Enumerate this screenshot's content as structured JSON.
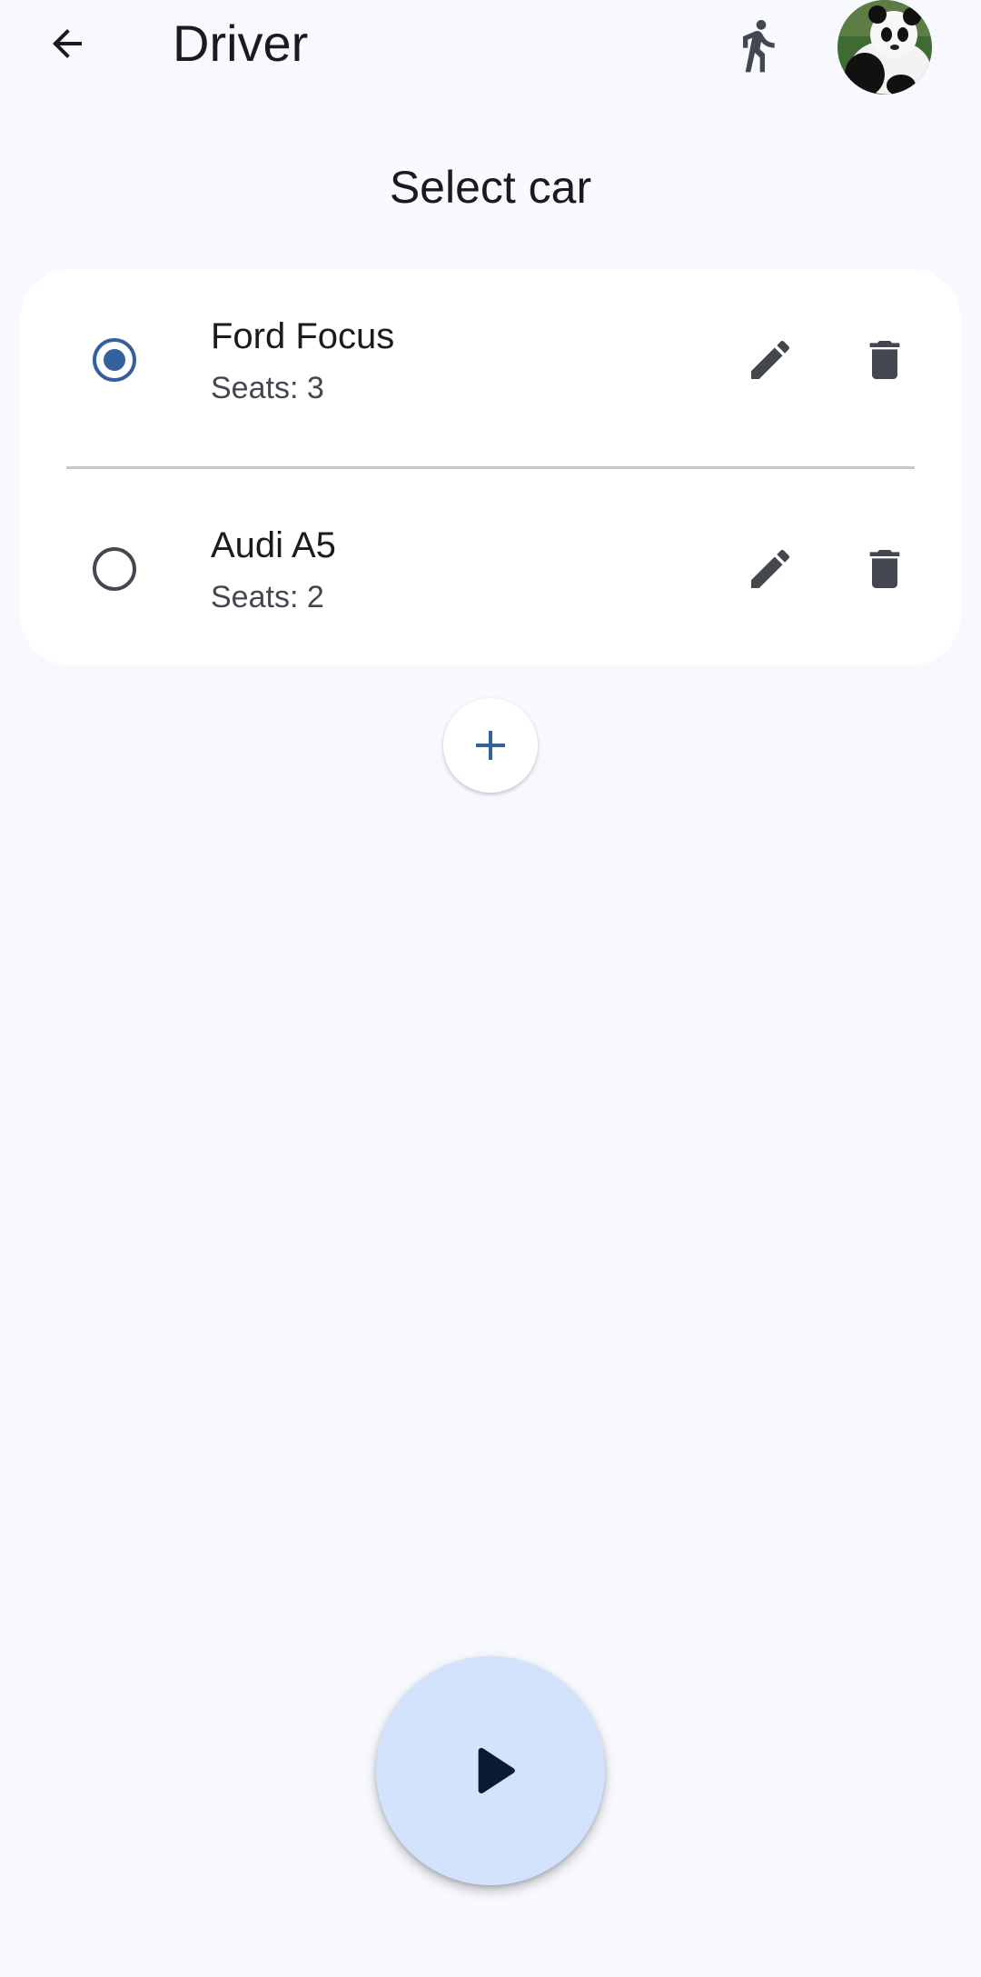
{
  "app_bar": {
    "title": "Driver",
    "back_icon": "arrow-back-icon",
    "mode_icon": "directions-walk-icon",
    "avatar_icon": "panda-avatar-icon"
  },
  "section": {
    "title": "Select car"
  },
  "cars": [
    {
      "name": "Ford Focus",
      "seats": "Seats: 3",
      "selected": true
    },
    {
      "name": "Audi A5",
      "seats": "Seats: 2",
      "selected": false
    }
  ],
  "icons": {
    "edit": "edit-pencil-icon",
    "delete": "trash-icon",
    "add": "plus-icon",
    "play": "play-icon"
  },
  "colors": {
    "background": "#f8f9ff",
    "card": "#ffffff",
    "accent": "#35609e",
    "fab": "#d3e3fd",
    "icon": "#44474f"
  }
}
